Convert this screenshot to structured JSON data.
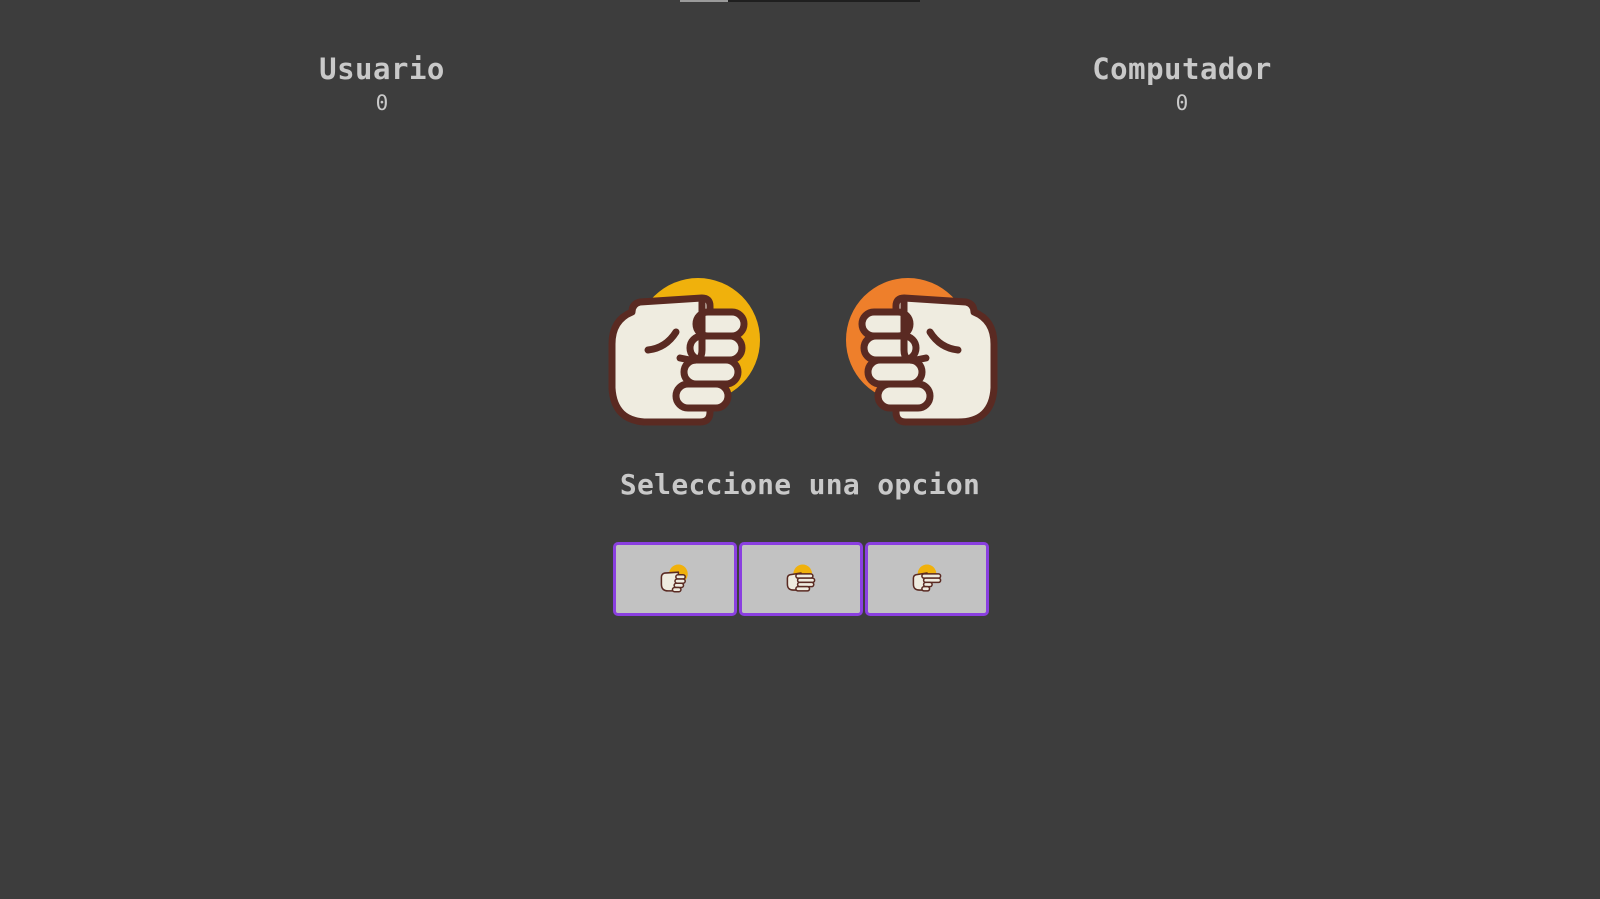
{
  "players": {
    "user": {
      "name": "Usuario",
      "score": "0"
    },
    "computer": {
      "name": "Computador",
      "score": "0"
    }
  },
  "prompt": "Seleccione una opcion",
  "hands": {
    "user": {
      "icon": "rock-hand-icon",
      "accent": "#f0b10c"
    },
    "computer": {
      "icon": "rock-hand-icon",
      "accent": "#ee7f2b"
    }
  },
  "options": [
    {
      "icon": "rock-hand-icon",
      "choice": "rock"
    },
    {
      "icon": "paper-hand-icon",
      "choice": "paper"
    },
    {
      "icon": "scissors-hand-icon",
      "choice": "scissors"
    }
  ],
  "colors": {
    "background": "#3d3d3d",
    "text": "#c9c9c9",
    "button_bg": "#c2c2c2",
    "button_border": "#8a3fe0",
    "hand_fill": "#efece0",
    "hand_outline": "#5a2a22"
  }
}
